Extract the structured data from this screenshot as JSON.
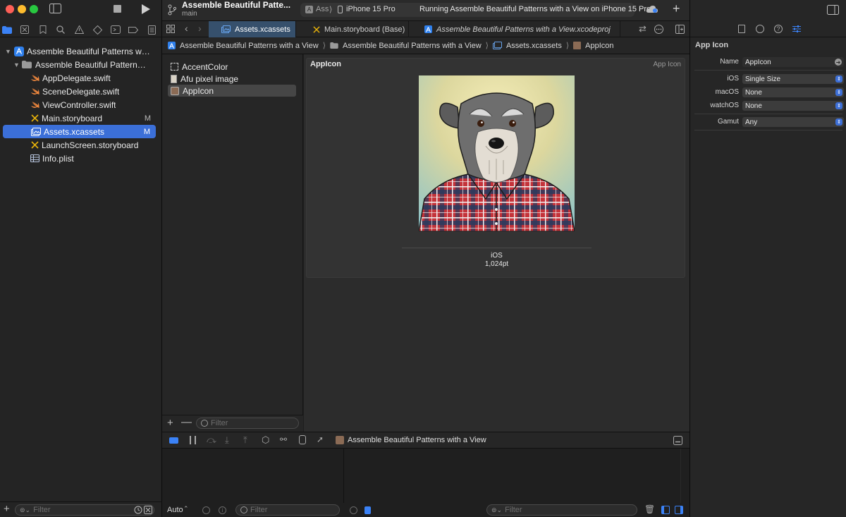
{
  "navigator": {
    "project_name": "Assemble Beautiful Patterns wit...",
    "group_name": "Assemble Beautiful Patterns...",
    "files": [
      {
        "name": "AppDelegate.swift",
        "badge": ""
      },
      {
        "name": "SceneDelegate.swift",
        "badge": ""
      },
      {
        "name": "ViewController.swift",
        "badge": ""
      },
      {
        "name": "Main.storyboard",
        "badge": "M"
      },
      {
        "name": "Assets.xcassets",
        "badge": "M"
      },
      {
        "name": "LaunchScreen.storyboard",
        "badge": ""
      },
      {
        "name": "Info.plist",
        "badge": ""
      }
    ],
    "filter_placeholder": "Filter"
  },
  "toolbar": {
    "scheme_title": "Assemble Beautiful Patte...",
    "branch": "main",
    "scheme_short": "Ass",
    "device": "iPhone 15 Pro",
    "status": "Running Assemble Beautiful Patterns with a View on iPhone 15 Pro"
  },
  "tabs": [
    {
      "label": "Assets.xcassets"
    },
    {
      "label": "Main.storyboard (Base)"
    },
    {
      "label": "Assemble Beautiful Patterns with a View.xcodeproj"
    }
  ],
  "jumpbar": {
    "project": "Assemble Beautiful Patterns with a View",
    "folder": "Assemble Beautiful Patterns with a View",
    "catalog": "Assets.xcassets",
    "asset": "AppIcon"
  },
  "asset_list": {
    "items": [
      "AccentColor",
      "Afu pixel image",
      "AppIcon"
    ],
    "filter_placeholder": "Filter"
  },
  "canvas": {
    "title": "AppIcon",
    "kind": "App Icon",
    "platform": "iOS",
    "size": "1,024pt"
  },
  "debug": {
    "process": "Assemble Beautiful Patterns with a View",
    "mode": "Auto",
    "filter_placeholder": "Filter",
    "filter_placeholder_2": "Filter"
  },
  "inspector": {
    "section": "App Icon",
    "rows": [
      {
        "key": "Name",
        "value": "AppIcon"
      },
      {
        "key": "iOS",
        "value": "Single Size"
      },
      {
        "key": "macOS",
        "value": "None"
      },
      {
        "key": "watchOS",
        "value": "None"
      },
      {
        "key": "Gamut",
        "value": "Any"
      }
    ]
  },
  "colors": {
    "accent": "#3b6fd8",
    "swift": "#f0883e",
    "storyboard": "#e8b30a"
  }
}
